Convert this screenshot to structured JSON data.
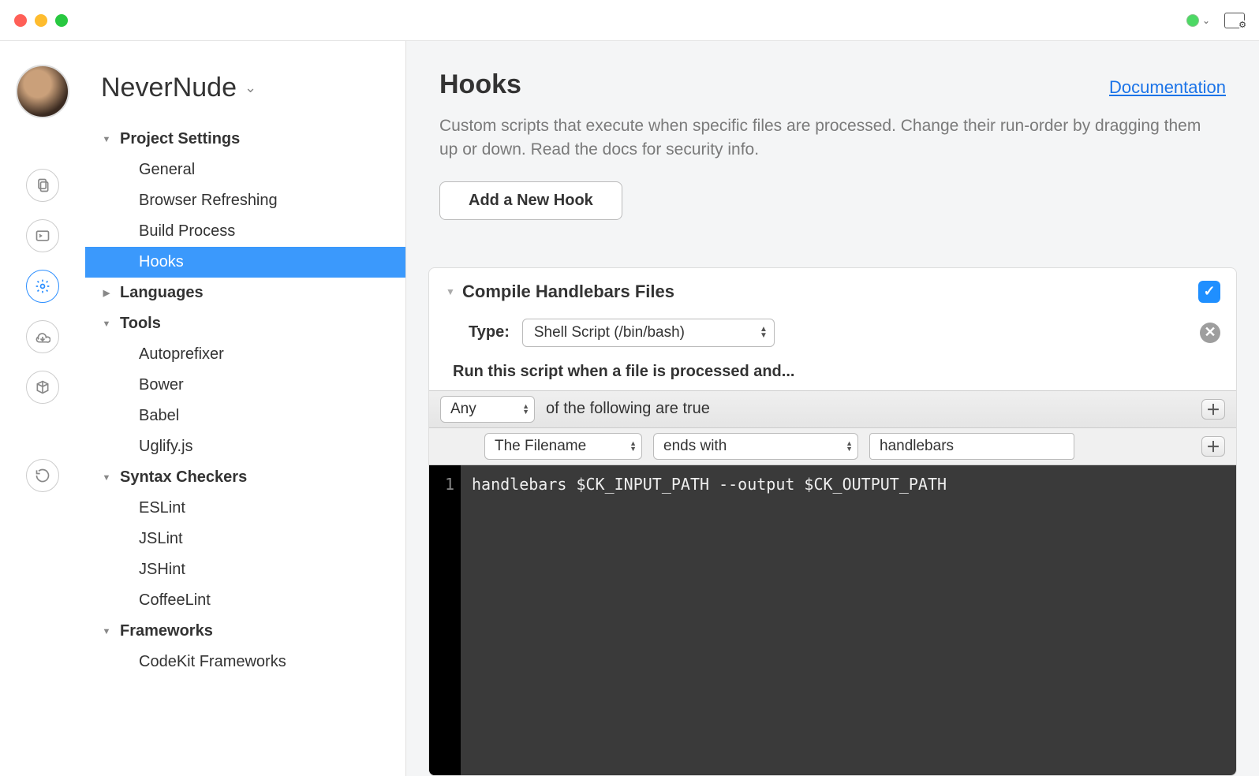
{
  "project": {
    "name": "NeverNude"
  },
  "sidebar": {
    "sections": [
      {
        "label": "Project Settings",
        "expanded": true,
        "items": [
          "General",
          "Browser Refreshing",
          "Build Process",
          "Hooks"
        ],
        "selectedIndex": 3
      },
      {
        "label": "Languages",
        "expanded": false,
        "items": []
      },
      {
        "label": "Tools",
        "expanded": true,
        "items": [
          "Autoprefixer",
          "Bower",
          "Babel",
          "Uglify.js"
        ]
      },
      {
        "label": "Syntax Checkers",
        "expanded": true,
        "items": [
          "ESLint",
          "JSLint",
          "JSHint",
          "CoffeeLint"
        ]
      },
      {
        "label": "Frameworks",
        "expanded": true,
        "items": [
          "CodeKit Frameworks"
        ]
      }
    ]
  },
  "page": {
    "title": "Hooks",
    "docLink": "Documentation",
    "description": "Custom scripts that execute when specific files are processed. Change their run-order by dragging them up or down. Read the docs for security info.",
    "addButton": "Add a New Hook"
  },
  "hook": {
    "title": "Compile Handlebars Files",
    "enabled": true,
    "typeLabel": "Type:",
    "typeValue": "Shell Script (/bin/bash)",
    "runLabel": "Run this script when a file is processed and...",
    "condition": {
      "anyAll": "Any",
      "anyAllSuffix": "of the following are true",
      "subject": "The Filename",
      "operator": "ends with",
      "value": "handlebars"
    },
    "code": {
      "lineNumber": "1",
      "text": "handlebars $CK_INPUT_PATH --output $CK_OUTPUT_PATH"
    }
  }
}
